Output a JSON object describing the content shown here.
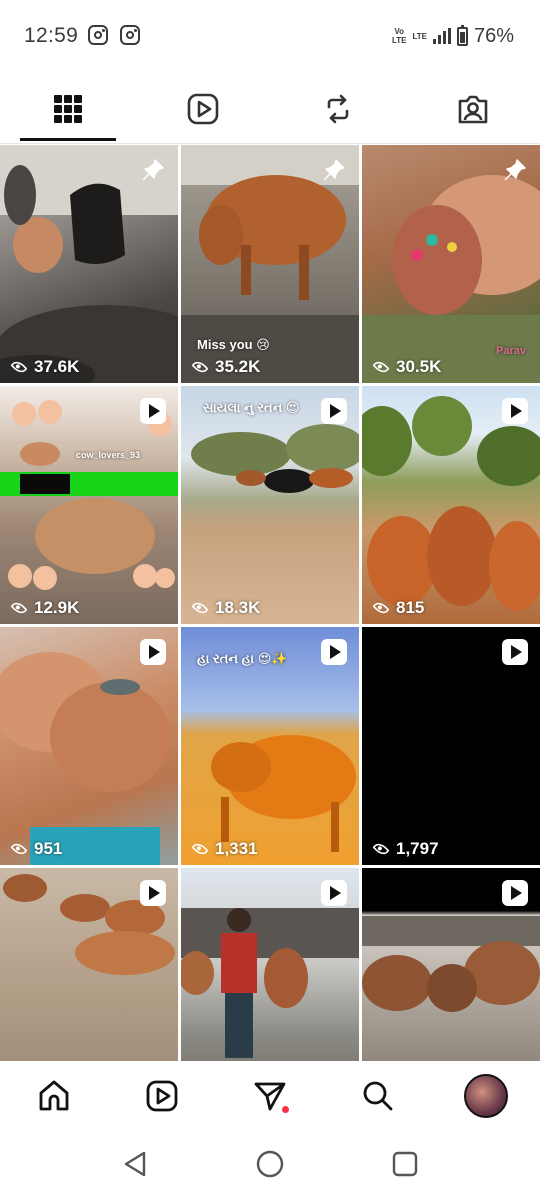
{
  "status_bar": {
    "time": "12:59",
    "net_label_top": "Vo",
    "net_label_bottom": "LTE",
    "lte_label": "LTE",
    "battery": "76%",
    "icons": [
      "instagram-icon",
      "instagram-icon",
      "signal-icon",
      "battery-icon"
    ]
  },
  "tabs": [
    {
      "icon": "grid-icon",
      "selected": true
    },
    {
      "icon": "reels-icon",
      "selected": false
    },
    {
      "icon": "repost-icon",
      "selected": false
    },
    {
      "icon": "tagged-icon",
      "selected": false
    }
  ],
  "grid": {
    "tiles": [
      {
        "views": "37.6K",
        "badge": "pin",
        "caption": ""
      },
      {
        "views": "35.2K",
        "badge": "pin",
        "caption": "Miss you 😢"
      },
      {
        "views": "30.5K",
        "badge": "pin",
        "caption": "Parav"
      },
      {
        "views": "12.9K",
        "badge": "play",
        "caption": "cow_lovers_93"
      },
      {
        "views": "18.3K",
        "badge": "play",
        "caption": "સાયલા નુ રતન 😍"
      },
      {
        "views": "815",
        "badge": "play",
        "caption": ""
      },
      {
        "views": "951",
        "badge": "play",
        "caption": ""
      },
      {
        "views": "1,331",
        "badge": "play",
        "caption": "હા રતન હા 😍✨"
      },
      {
        "views": "1,797",
        "badge": "play",
        "caption": ""
      },
      {
        "views": "",
        "badge": "play",
        "caption": ""
      },
      {
        "views": "",
        "badge": "play",
        "caption": ""
      },
      {
        "views": "",
        "badge": "play",
        "caption": ""
      }
    ]
  },
  "bottom_nav": {
    "items": [
      "home-icon",
      "reels-icon",
      "direct-message-icon",
      "search-icon",
      "profile-avatar"
    ],
    "notification_color": "#ff3040"
  },
  "system_nav": {
    "items": [
      "back-icon",
      "home-circle-icon",
      "recents-icon"
    ]
  },
  "colors": {
    "accent_dot": "#ff3040",
    "text": "#1c1c1c",
    "icon": "#1c1c1c"
  }
}
